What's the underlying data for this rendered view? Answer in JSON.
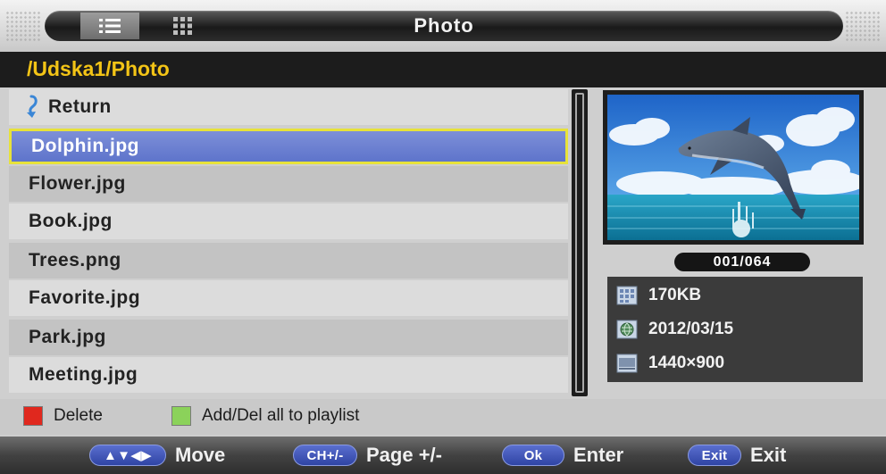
{
  "header": {
    "title": "Photo",
    "view_modes": [
      {
        "name": "list-view",
        "icon": "list-icon",
        "active": true
      },
      {
        "name": "thumbnail-view",
        "icon": "grid-icon",
        "active": false
      }
    ]
  },
  "path": "/Udska1/Photo",
  "file_list": {
    "return_label": "Return",
    "return_icon": "return-icon",
    "selected_index": 0,
    "items": [
      "Dolphin.jpg",
      "Flower.jpg",
      "Book.jpg",
      "Trees.png",
      "Favorite.jpg",
      "Park.jpg",
      "Meeting.jpg"
    ]
  },
  "preview": {
    "counter": "001/064",
    "image_subject": "dolphin leaping over the sea",
    "info": {
      "size": "170KB",
      "size_icon": "file-size-icon",
      "date": "2012/03/15",
      "date_icon": "globe-date-icon",
      "resolution": "1440×900",
      "resolution_icon": "resolution-icon"
    }
  },
  "legend": {
    "delete": {
      "label": "Delete",
      "color": "#e0281e"
    },
    "playlist": {
      "label": "Add/Del all to playlist",
      "color": "#8bd25a"
    }
  },
  "help": [
    {
      "key": "▲▼◀▶",
      "label": "Move"
    },
    {
      "key": "CH+/-",
      "label": "Page +/-"
    },
    {
      "key": "Ok",
      "label": "Enter"
    },
    {
      "key": "Exit",
      "label": "Exit"
    }
  ],
  "colors": {
    "path_text": "#f3c416",
    "selection_fill": "#6a7ed0",
    "selection_border": "#e7e23a",
    "key_badge": "#3c51b4"
  }
}
